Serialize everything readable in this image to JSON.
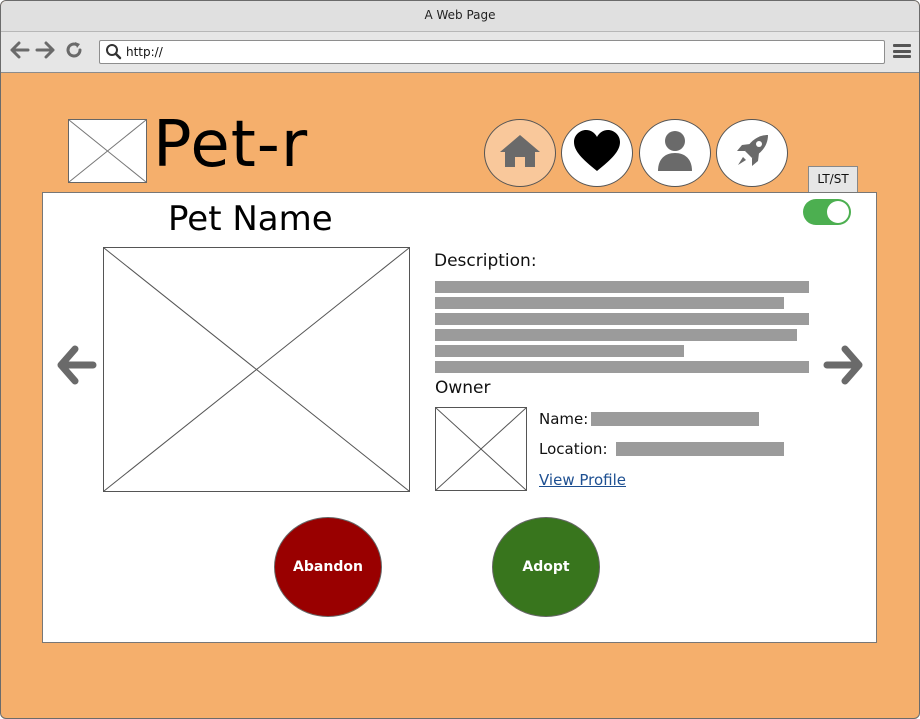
{
  "window": {
    "title": "A Web Page"
  },
  "browser": {
    "url": "http://",
    "back_icon": "arrow-left-icon",
    "forward_icon": "arrow-right-icon",
    "reload_icon": "reload-icon",
    "search_icon": "search-icon",
    "menu_icon": "hamburger-menu-icon"
  },
  "header": {
    "brand": "Pet-r",
    "nav": [
      {
        "name": "home",
        "icon": "home-icon",
        "active": true
      },
      {
        "name": "favorites",
        "icon": "heart-icon",
        "active": false
      },
      {
        "name": "profile",
        "icon": "user-icon",
        "active": false
      },
      {
        "name": "launch",
        "icon": "rocket-icon",
        "active": false
      }
    ],
    "mode_badge": "LT/ST"
  },
  "card": {
    "pet_name": "Pet Name",
    "toggle_on": true,
    "description_label": "Description:",
    "owner_label": "Owner",
    "name_label": "Name:",
    "location_label": "Location:",
    "view_profile": "View Profile",
    "abandon_label": "Abandon",
    "adopt_label": "Adopt"
  },
  "colors": {
    "page_background": "#f5af6c",
    "toggle": "#4caf50",
    "abandon": "#990000",
    "adopt": "#38751d",
    "link": "#1d4f91"
  }
}
